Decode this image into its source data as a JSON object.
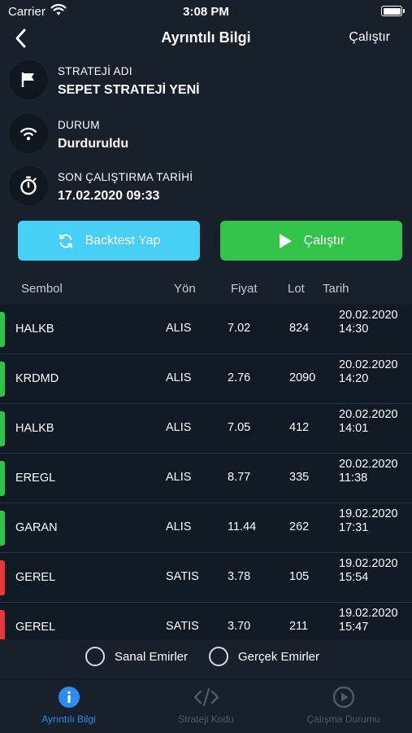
{
  "status_bar": {
    "carrier": "Carrier",
    "time": "3:08 PM"
  },
  "nav": {
    "title": "Ayrıntılı Bilgi",
    "action": "Çalıştır"
  },
  "info": [
    {
      "label": "STRATEJİ ADI",
      "value": "SEPET STRATEJİ YENİ",
      "icon": "flag-icon"
    },
    {
      "label": "DURUM",
      "value": "Durduruldu",
      "icon": "wifi-icon"
    },
    {
      "label": "SON ÇALIŞTIRMA TARİHİ",
      "value": "17.02.2020 09:33",
      "icon": "stopwatch-icon"
    }
  ],
  "buttons": {
    "backtest": "Backtest Yap",
    "run": "Çalıştır"
  },
  "table": {
    "headers": {
      "symbol": "Sembol",
      "direction": "Yön",
      "price": "Fiyat",
      "lot": "Lot",
      "date": "Tarih"
    },
    "rows": [
      {
        "symbol": "HALKB",
        "direction": "ALIS",
        "price": "7.02",
        "lot": "824",
        "date": "20.02.2020",
        "time": "14:30",
        "side": "buy"
      },
      {
        "symbol": "KRDMD",
        "direction": "ALIS",
        "price": "2.76",
        "lot": "2090",
        "date": "20.02.2020",
        "time": "14:20",
        "side": "buy"
      },
      {
        "symbol": "HALKB",
        "direction": "ALIS",
        "price": "7.05",
        "lot": "412",
        "date": "20.02.2020",
        "time": "14:01",
        "side": "buy"
      },
      {
        "symbol": "EREGL",
        "direction": "ALIS",
        "price": "8.77",
        "lot": "335",
        "date": "20.02.2020",
        "time": "11:38",
        "side": "buy"
      },
      {
        "symbol": "GARAN",
        "direction": "ALIS",
        "price": "11.44",
        "lot": "262",
        "date": "19.02.2020",
        "time": "17:31",
        "side": "buy"
      },
      {
        "symbol": "GEREL",
        "direction": "SATIS",
        "price": "3.78",
        "lot": "105",
        "date": "19.02.2020",
        "time": "15:54",
        "side": "sell"
      },
      {
        "symbol": "GEREL",
        "direction": "SATIS",
        "price": "3.70",
        "lot": "211",
        "date": "19.02.2020",
        "time": "15:47",
        "side": "sell"
      }
    ]
  },
  "filters": {
    "virtual": "Sanal Emirler",
    "real": "Gerçek Emirler"
  },
  "tabs": [
    {
      "label": "Ayrıntılı Bilgi",
      "icon": "info-icon",
      "active": true
    },
    {
      "label": "Strateji Kodu",
      "icon": "code-icon",
      "active": false
    },
    {
      "label": "Çalışma Durumu",
      "icon": "play-circle-icon",
      "active": false
    }
  ],
  "colors": {
    "buy": "#34c34a",
    "sell": "#e8383a",
    "backtest": "#46d0f7",
    "run": "#34c34a",
    "tab_active": "#2d8cf0"
  }
}
